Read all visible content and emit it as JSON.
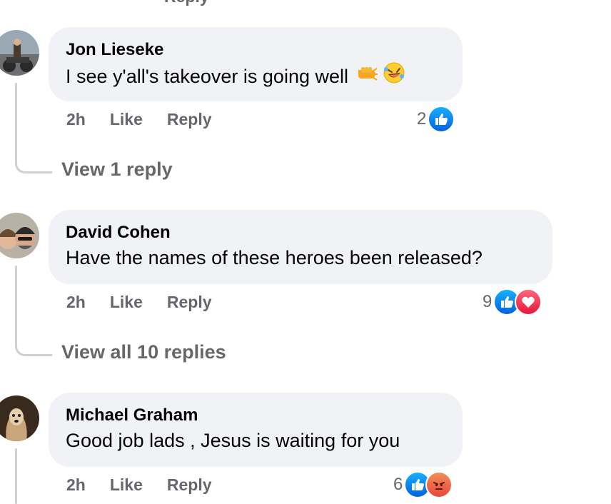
{
  "previous_partial_label": "Reply",
  "comments": [
    {
      "author": "Jon Lieseke",
      "text": "I see y'all's takeover is going well",
      "emojis": [
        "fist-bump-emoji",
        "rolling-laughing-emoji"
      ],
      "time": "2h",
      "like_label": "Like",
      "reply_label": "Reply",
      "reaction_count": "2",
      "reactions": [
        "like"
      ],
      "view_replies": "View 1 reply"
    },
    {
      "author": "David Cohen",
      "text": "Have the names of these heroes been released?",
      "emojis": [],
      "time": "2h",
      "like_label": "Like",
      "reply_label": "Reply",
      "reaction_count": "9",
      "reactions": [
        "like",
        "love"
      ],
      "view_replies": "View all 10 replies"
    },
    {
      "author": "Michael Graham",
      "text": "Good job lads , Jesus is waiting for you",
      "emojis": [],
      "time": "2h",
      "like_label": "Like",
      "reply_label": "Reply",
      "reaction_count": "6",
      "reactions": [
        "like",
        "angry"
      ]
    }
  ],
  "colors": {
    "bubble": "#f0f2f5",
    "meta_text": "#65676b",
    "like_blue": "#1877f2",
    "love_red": "#f33e58",
    "angry_orange": "#e9710f"
  }
}
